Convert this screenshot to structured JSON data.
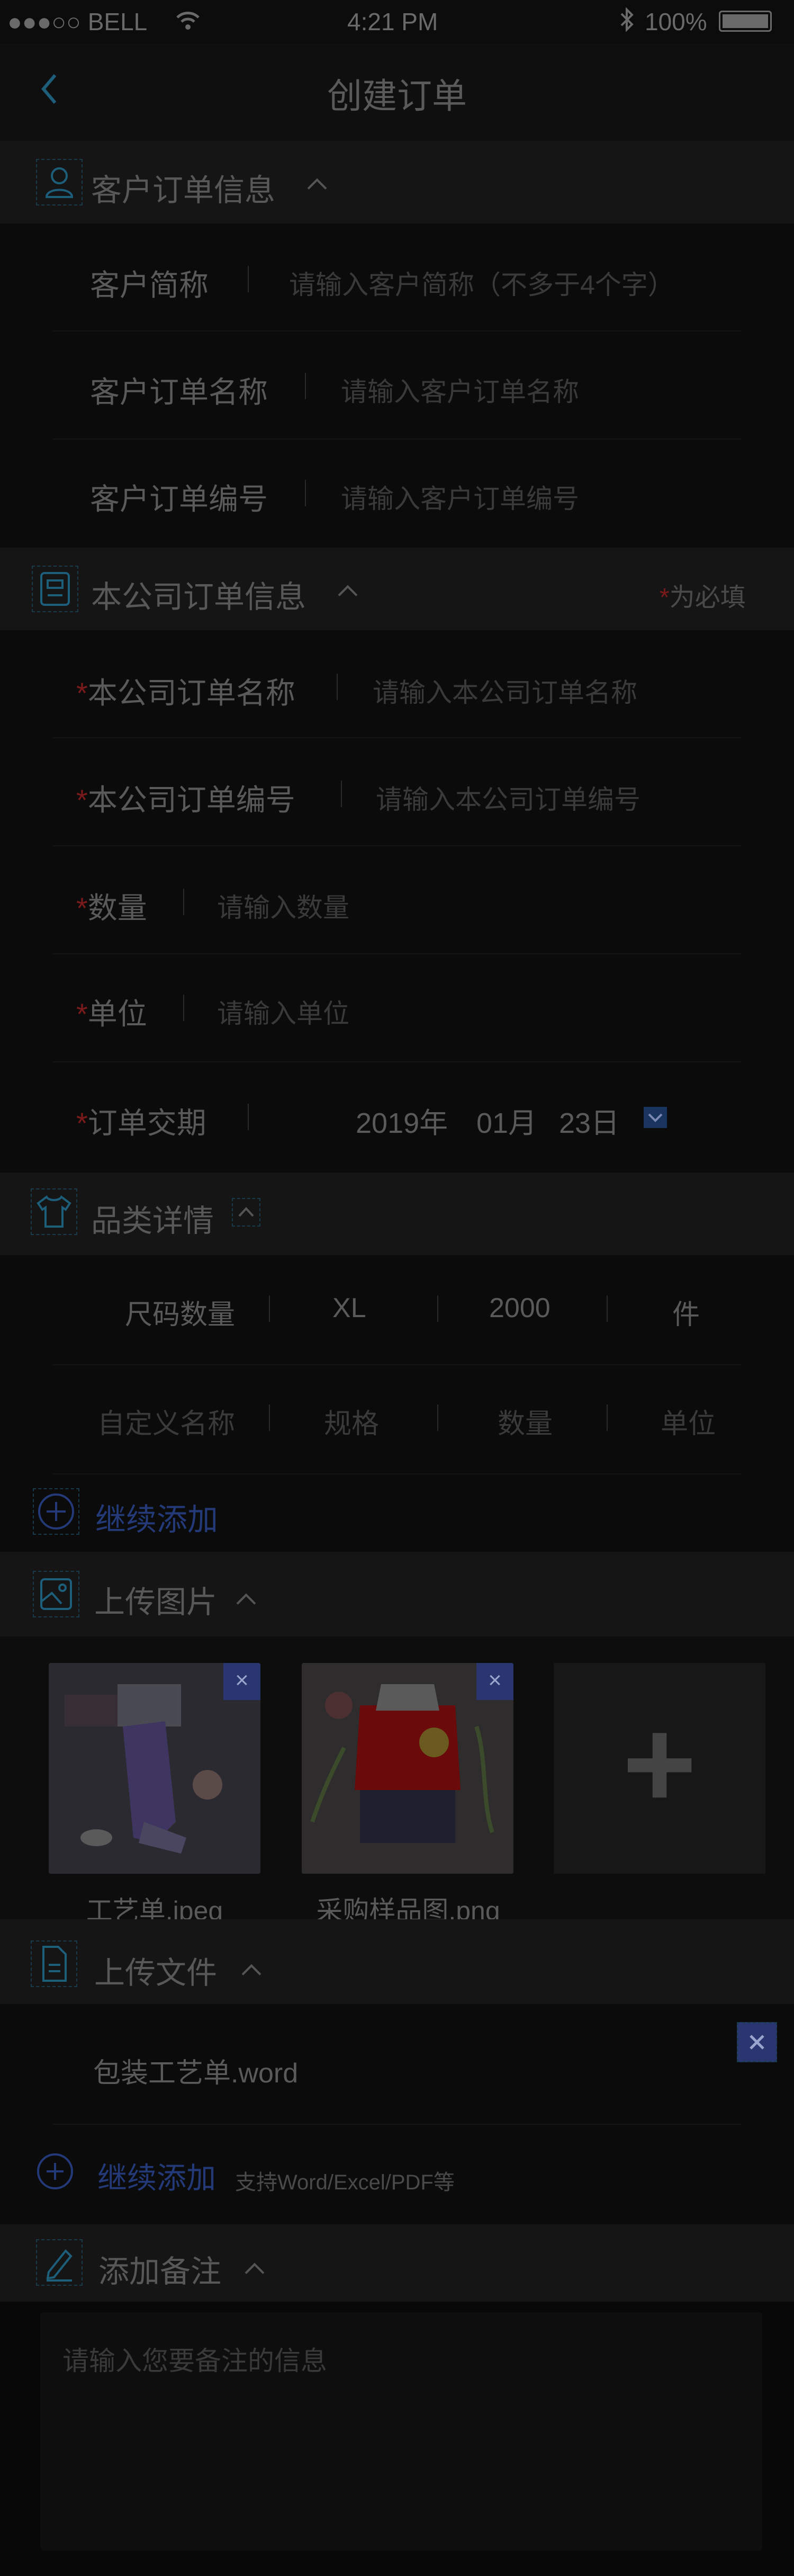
{
  "status": {
    "carrier": "●●●○○ BELL",
    "time": "4:21 PM",
    "battery": "100%"
  },
  "nav": {
    "title": "创建订单"
  },
  "customer": {
    "title": "客户订单信息",
    "rows": [
      {
        "label": "客户简称",
        "placeholder": "请输入客户简称（不多于4个字）"
      },
      {
        "label": "客户订单名称",
        "placeholder": "请输入客户订单名称"
      },
      {
        "label": "客户订单编号",
        "placeholder": "请输入客户订单编号"
      }
    ]
  },
  "company": {
    "title": "本公司订单信息",
    "required_star": "*",
    "required_note": "为必填",
    "rows": [
      {
        "label": "本公司订单名称",
        "placeholder": "请输入本公司订单名称"
      },
      {
        "label": "本公司订单编号",
        "placeholder": "请输入本公司订单编号"
      },
      {
        "label": "数量",
        "placeholder": "请输入数量"
      },
      {
        "label": "单位",
        "placeholder": "请输入单位"
      }
    ],
    "date": {
      "label": "订单交期",
      "year": "2019年",
      "month": "01月",
      "day": "23日"
    }
  },
  "category": {
    "title": "品类详情",
    "row1": [
      "尺码数量",
      "XL",
      "2000",
      "件"
    ],
    "row2": [
      "自定义名称",
      "规格",
      "数量",
      "单位"
    ],
    "add_label": "继续添加"
  },
  "images": {
    "title": "上传图片",
    "items": [
      {
        "name": "工艺单.jpeg"
      },
      {
        "name": "采购样品图.png"
      }
    ],
    "close": "×",
    "add": "+"
  },
  "files": {
    "title": "上传文件",
    "items": [
      {
        "name": "包装工艺单.word"
      }
    ],
    "add_label": "继续添加",
    "hint": "支持Word/Excel/PDF等"
  },
  "note": {
    "title": "添加备注",
    "placeholder": "请输入您要备注的信息"
  },
  "colors": {
    "accent": "#243a78",
    "required": "#7a1a1a",
    "icon_teal": "#1a3a4a"
  }
}
